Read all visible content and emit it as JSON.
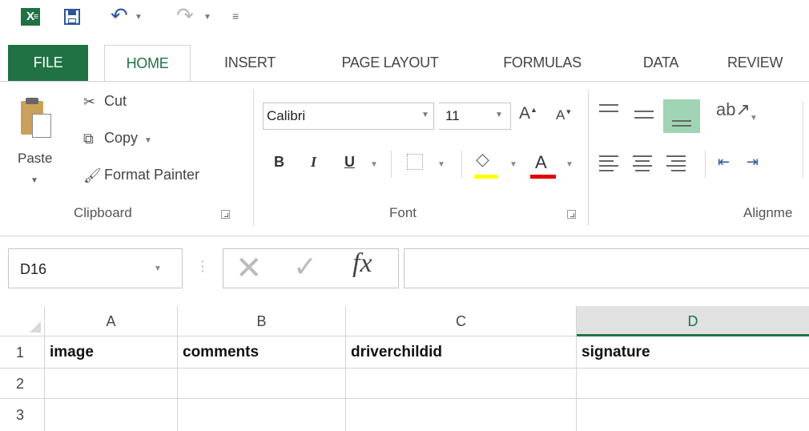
{
  "qat": {
    "app_icon": "excel-icon",
    "save_icon": "save-icon",
    "undo_icon": "undo-icon",
    "redo_icon": "redo-icon"
  },
  "tabs": [
    {
      "label": "FILE"
    },
    {
      "label": "HOME"
    },
    {
      "label": "INSERT"
    },
    {
      "label": "PAGE LAYOUT"
    },
    {
      "label": "FORMULAS"
    },
    {
      "label": "DATA"
    },
    {
      "label": "REVIEW"
    }
  ],
  "clipboard": {
    "paste": "Paste",
    "cut": "Cut",
    "copy": "Copy",
    "format_painter": "Format Painter",
    "group_label": "Clipboard"
  },
  "font": {
    "name": "Calibri",
    "size": "11",
    "bold": "B",
    "italic": "I",
    "underline": "U",
    "font_color_glyph": "A",
    "grow_glyph": "A",
    "shrink_glyph": "A",
    "group_label": "Font",
    "colors": {
      "highlight": "#ffff00",
      "font_color": "#e00000"
    }
  },
  "alignment": {
    "group_label": "Alignme"
  },
  "formula_bar": {
    "name_box": "D16",
    "fx": "fx",
    "formula": ""
  },
  "grid": {
    "columns": [
      "A",
      "B",
      "C",
      "D"
    ],
    "selected_column": "D",
    "rows": [
      {
        "num": "1",
        "cells": [
          "image",
          "comments",
          "driverchildid",
          "signature"
        ]
      },
      {
        "num": "2",
        "cells": [
          "",
          "",
          "",
          ""
        ]
      },
      {
        "num": "3",
        "cells": [
          "",
          "",
          "",
          ""
        ]
      }
    ]
  },
  "colors": {
    "accent": "#217346",
    "file_tab": "#207245",
    "selected_align": "#9fd5b4"
  }
}
